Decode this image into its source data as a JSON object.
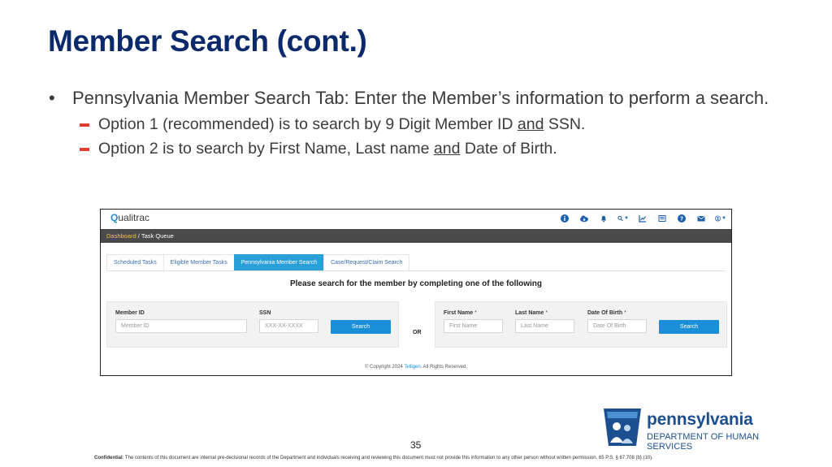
{
  "slide": {
    "title": "Member Search (cont.)",
    "bullet_main": "Pennsylvania Member Search Tab: Enter the Member’s information to perform a search.",
    "sub1_pre": "Option 1 (recommended) is to search by 9 Digit Member ID ",
    "sub1_and": "and",
    "sub1_post": " SSN.",
    "sub2_pre": "Option 2 is to search by First Name, Last name ",
    "sub2_and": "and",
    "sub2_post": " Date of Birth.",
    "page_number": "35",
    "footer_bold": "Confidential",
    "footer_text": ": The contents of this document are internal pre-decisional records of the Department and individuals receiving and reviewing this document must not provide this information to any other person without written permission. 65 P.S. § 67.708 (b) (10)."
  },
  "app": {
    "logo": "ualitrac",
    "logo_letter": "Q",
    "header_icons": [
      "info-icon",
      "cloud-download-icon",
      "bell-icon",
      "search-icon",
      "chart-icon",
      "list-icon",
      "help-icon",
      "mail-icon",
      "user-icon"
    ],
    "breadcrumb": {
      "home": "Dashboard",
      "sep": " / ",
      "current": "Task Queue"
    },
    "tabs": [
      {
        "label": "Scheduled Tasks",
        "active": false
      },
      {
        "label": "Eligible Member Tasks",
        "active": false
      },
      {
        "label": "Pennsylvania Member Search",
        "active": true
      },
      {
        "label": "Case/Request/Claim Search",
        "active": false
      }
    ],
    "prompt": "Please search for the member by completing one of the following",
    "left_form": {
      "member_id_label": "Member ID",
      "member_id_placeholder": "Member ID",
      "ssn_label": "SSN",
      "ssn_placeholder": "XXX-XX-XXXX",
      "search_button": "Search"
    },
    "or_label": "OR",
    "right_form": {
      "first_name_label": "First Name",
      "first_name_placeholder": "First Name",
      "last_name_label": "Last Name",
      "last_name_placeholder": "Last Name",
      "dob_label": "Date Of Birth",
      "dob_placeholder": "Date Of Birth",
      "required_mark": "*",
      "search_button": "Search"
    },
    "copyright_pre": "© Copyright 2024 ",
    "copyright_brand": "Telligen",
    "copyright_post": ". All Rights Reserved."
  },
  "dhs_logo": {
    "name": "pennsylvania",
    "department": "DEPARTMENT OF HUMAN SERVICES"
  },
  "colors": {
    "title": "#0b2a6b",
    "accent_dash": "#e03c31",
    "tab_active": "#2a9fd8",
    "button": "#1a8fd8",
    "breadcrumb_bar": "#4a4a4a",
    "dhs_blue": "#1b4f8f"
  }
}
